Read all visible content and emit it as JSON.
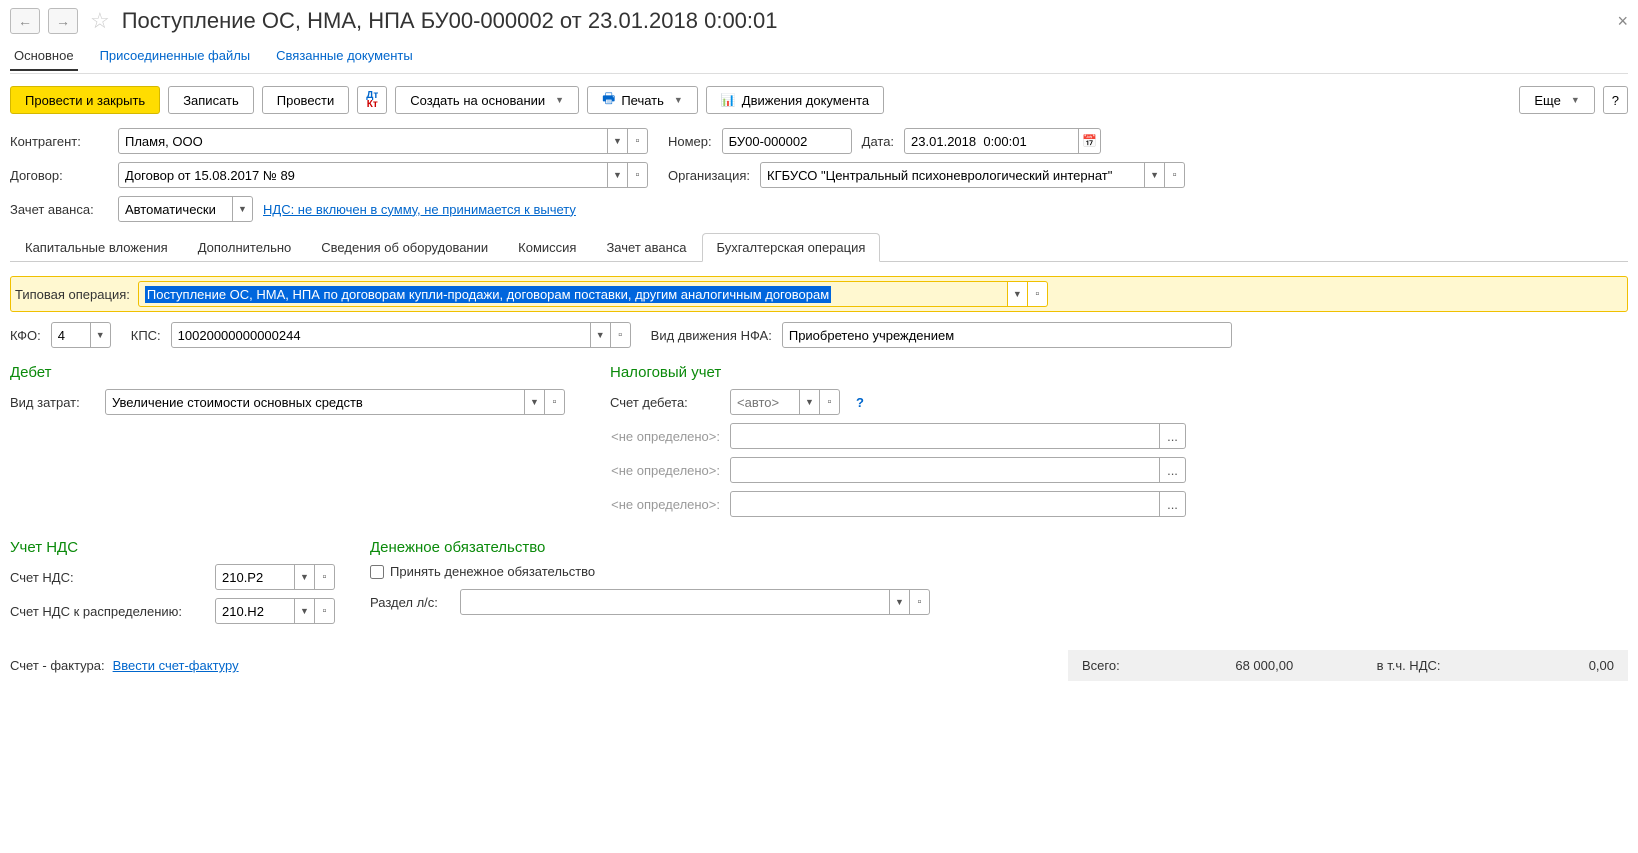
{
  "title": "Поступление ОС, НМА, НПА БУ00-000002 от 23.01.2018 0:00:01",
  "nav_tabs": {
    "main": "Основное",
    "files": "Присоединенные файлы",
    "linked": "Связанные документы"
  },
  "toolbar": {
    "post_close": "Провести и закрыть",
    "save": "Записать",
    "post": "Провести",
    "create_based": "Создать на основании",
    "print": "Печать",
    "movements": "Движения документа",
    "more": "Еще",
    "help": "?"
  },
  "labels": {
    "counterparty": "Контрагент:",
    "number": "Номер:",
    "date": "Дата:",
    "contract": "Договор:",
    "organization": "Организация:",
    "advance_offset": "Зачет аванса:",
    "vat_link": "НДС: не включен в сумму, не принимается к вычету",
    "typical_op": "Типовая операция:",
    "kfo": "КФО:",
    "kps": "КПС:",
    "nfa_movement": "Вид движения НФА:",
    "debit": "Дебет",
    "cost_type": "Вид затрат:",
    "tax_accounting": "Налоговый учет",
    "debit_account": "Счет дебета:",
    "not_defined": "<не определено>:",
    "vat_accounting": "Учет НДС",
    "monetary_obligation": "Денежное обязательство",
    "vat_account": "Счет НДС:",
    "vat_account_dist": "Счет НДС к распределению:",
    "accept_obligation": "Принять денежное обязательство",
    "ls_section": "Раздел л/c:",
    "invoice": "Счет - фактура:",
    "enter_invoice": "Ввести счет-фактуру",
    "total": "Всего:",
    "incl_vat": "в т.ч. НДС:"
  },
  "values": {
    "counterparty": "Пламя, ООО",
    "number": "БУ00-000002",
    "date": "23.01.2018  0:00:01",
    "contract": "Договор от 15.08.2017 № 89",
    "organization": "КГБУСО \"Центральный психоневрологический интернат\"",
    "advance_offset": "Автоматически",
    "typical_op": "Поступление ОС, НМА, НПА по договорам купли-продажи, договорам поставки, другим аналогичным договорам",
    "kfo": "4",
    "kps": "10020000000000244",
    "nfa_movement": "Приобретено учреждением",
    "cost_type": "Увеличение стоимости основных средств",
    "debit_account_placeholder": "<авто>",
    "vat_account": "210.Р2",
    "vat_account_dist": "210.Н2",
    "ls_section": "",
    "total": "68 000,00",
    "vat_total": "0,00"
  },
  "sub_tabs": {
    "capital": "Капитальные вложения",
    "additional": "Дополнительно",
    "equipment": "Сведения об оборудовании",
    "commission": "Комиссия",
    "advance": "Зачет аванса",
    "accounting_op": "Бухгалтерская операция"
  }
}
